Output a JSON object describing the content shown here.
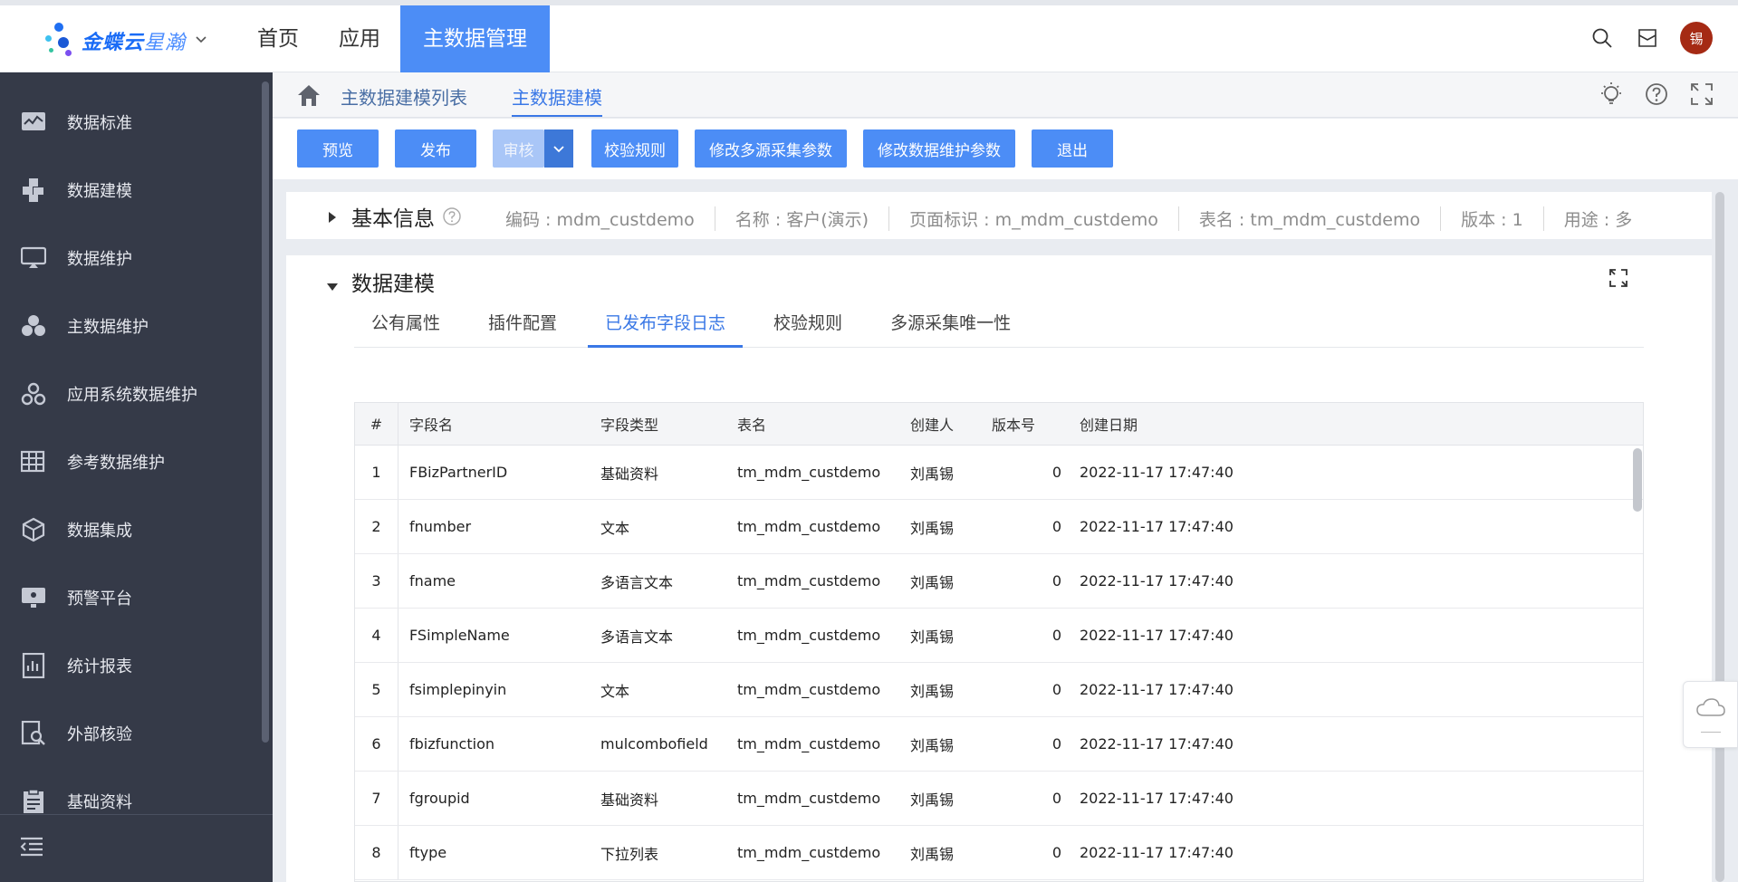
{
  "header": {
    "brand": {
      "part1": "金蝶云",
      "part2": "星瀚"
    },
    "nav": [
      "首页",
      "应用",
      "主数据管理"
    ],
    "avatar_text": "锡",
    "colors": {
      "accent": "#4c8df6",
      "sidebar_bg": "#353a48"
    }
  },
  "sidebar": {
    "items": [
      {
        "label": "数据标准",
        "icon": "monitor-chart-icon"
      },
      {
        "label": "数据建模",
        "icon": "blocks-icon"
      },
      {
        "label": "数据维护",
        "icon": "screen-icon"
      },
      {
        "label": "主数据维护",
        "icon": "cluster-icon"
      },
      {
        "label": "应用系统数据维护",
        "icon": "gears-icon"
      },
      {
        "label": "参考数据维护",
        "icon": "table-icon"
      },
      {
        "label": "数据集成",
        "icon": "cube-icon"
      },
      {
        "label": "预警平台",
        "icon": "alert-screen-icon"
      },
      {
        "label": "统计报表",
        "icon": "report-icon"
      },
      {
        "label": "外部核验",
        "icon": "magnifier-doc-icon"
      },
      {
        "label": "基础资料",
        "icon": "clipboard-icon"
      }
    ]
  },
  "breadcrumb": [
    "主数据建模列表",
    "主数据建模"
  ],
  "toolbar": {
    "preview": "预览",
    "publish": "发布",
    "audit": "审核",
    "check_rules": "校验规则",
    "edit_multi_source": "修改多源采集参数",
    "edit_maintenance": "修改数据维护参数",
    "exit": "退出"
  },
  "basic_info": {
    "title": "基本信息",
    "meta": [
      "编码 : mdm_custdemo",
      "名称 : 客户(演示)",
      "页面标识 : m_mdm_custdemo",
      "表名 : tm_mdm_custdemo",
      "版本 : 1",
      "用途 : 多"
    ]
  },
  "modeling": {
    "title": "数据建模",
    "tabs": [
      "公有属性",
      "插件配置",
      "已发布字段日志",
      "校验规则",
      "多源采集唯一性"
    ],
    "active_tab": 2
  },
  "grid": {
    "headers": [
      "#",
      "字段名",
      "字段类型",
      "表名",
      "创建人",
      "版本号",
      "创建日期"
    ],
    "rows": [
      [
        "1",
        "FBizPartnerID",
        "基础资料",
        "tm_mdm_custdemo",
        "刘禹锡",
        "0",
        "2022-11-17 17:47:40"
      ],
      [
        "2",
        "fnumber",
        "文本",
        "tm_mdm_custdemo",
        "刘禹锡",
        "0",
        "2022-11-17 17:47:40"
      ],
      [
        "3",
        "fname",
        "多语言文本",
        "tm_mdm_custdemo",
        "刘禹锡",
        "0",
        "2022-11-17 17:47:40"
      ],
      [
        "4",
        "FSimpleName",
        "多语言文本",
        "tm_mdm_custdemo",
        "刘禹锡",
        "0",
        "2022-11-17 17:47:40"
      ],
      [
        "5",
        "fsimplepinyin",
        "文本",
        "tm_mdm_custdemo",
        "刘禹锡",
        "0",
        "2022-11-17 17:47:40"
      ],
      [
        "6",
        "fbizfunction",
        "mulcombofield",
        "tm_mdm_custdemo",
        "刘禹锡",
        "0",
        "2022-11-17 17:47:40"
      ],
      [
        "7",
        "fgroupid",
        "基础资料",
        "tm_mdm_custdemo",
        "刘禹锡",
        "0",
        "2022-11-17 17:47:40"
      ],
      [
        "8",
        "ftype",
        "下拉列表",
        "tm_mdm_custdemo",
        "刘禹锡",
        "0",
        "2022-11-17 17:47:40"
      ]
    ]
  }
}
